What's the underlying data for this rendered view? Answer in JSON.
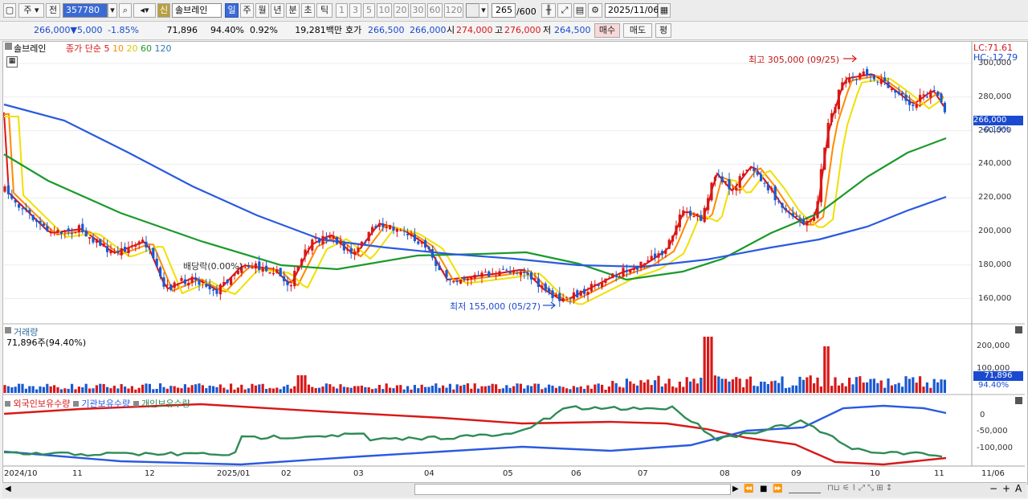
{
  "toolbar": {
    "mode_label": "주",
    "prev_label": "전",
    "code": "357780",
    "badge_new": "신",
    "name": "솔브레인",
    "periods": [
      "일",
      "주",
      "월",
      "년",
      "분",
      "초",
      "틱"
    ],
    "minutes": [
      "1",
      "3",
      "5",
      "10",
      "20",
      "30",
      "60",
      "120"
    ],
    "count": "265",
    "total": "/600",
    "date": "2025/11/06"
  },
  "quote": {
    "price": "266,000",
    "arrow": "▼",
    "change": "5,000",
    "change_pct": "-1.85%",
    "volume": "71,896",
    "vol_ratio": "94.40%",
    "turnover_pct": "0.92%",
    "amount": "19,281백만",
    "hoga_label": "호가",
    "ask": "266,500",
    "bid": "266,000",
    "open_label": "시",
    "open": "274,000",
    "high_label": "고",
    "high": "276,000",
    "low_label": "저",
    "low": "264,500",
    "buy_label": "매수",
    "sell_label": "매도",
    "eval_label": "평"
  },
  "main_chart": {
    "title": "솔브레인",
    "ma_label": "종가 단순",
    "ma_periods": [
      "5",
      "10",
      "20",
      "60",
      "120"
    ],
    "ma_colors": [
      "#e01010",
      "#ff8a00",
      "#f0e000",
      "#1a9a2a",
      "#2a5ae0"
    ],
    "lc": "LC:71.61",
    "hc": "HC:-12.79",
    "y_ticks": [
      "300,000",
      "280,000",
      "260,000",
      "240,000",
      "220,000",
      "200,000",
      "180,000",
      "160,000"
    ],
    "price_tag": "266,000",
    "price_tag_pct": "-0.19%",
    "high_note": "최고 305,000 (09/25)",
    "low_note": "최저 155,000 (05/27)",
    "ex_div_note": "배당락(0.00%)",
    "up_color": "#d81818",
    "down_color": "#1a5ad0"
  },
  "volume_chart": {
    "title": "거래량",
    "value_note": "71,896주(94.40%)",
    "y_ticks": [
      "200,000",
      "100,000"
    ],
    "tag": "71,896",
    "tag_pct": "94.40%"
  },
  "holder_chart": {
    "labels": [
      "외국인보유수량",
      "기관보유수량",
      "개인보유수량"
    ],
    "colors": [
      "#d81818",
      "#2a5ae0",
      "#2e8b57"
    ],
    "y_ticks": [
      "0",
      "-50,000",
      "-100,000"
    ]
  },
  "x_axis": [
    "2024/10",
    "11",
    "12",
    "2025/01",
    "02",
    "03",
    "04",
    "05",
    "06",
    "07",
    "08",
    "09",
    "10",
    "11",
    "11/06"
  ],
  "scroll": {
    "zoom_out": "−",
    "zoom_in": "+",
    "font": "A"
  }
}
